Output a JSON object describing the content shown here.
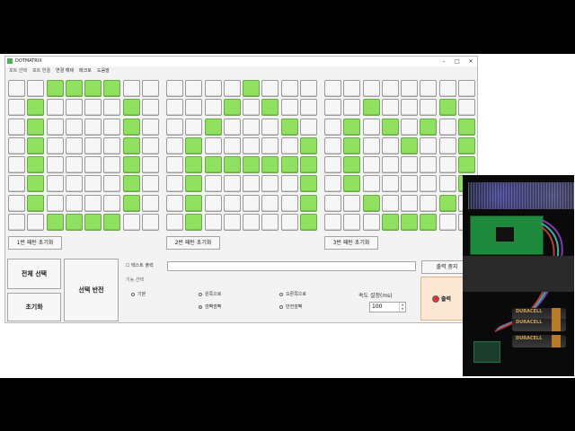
{
  "window": {
    "title": "DOTMATRIX",
    "controls": [
      "–",
      "□",
      "✕"
    ]
  },
  "menu": [
    "포트 선택",
    "포트 연결",
    "연결 해제",
    "매크로",
    "도움말"
  ],
  "panels": [
    {
      "reset_label": "1번 패턴 초기화",
      "rows": [
        [
          0,
          0,
          1,
          1,
          1,
          1,
          0,
          0
        ],
        [
          0,
          1,
          0,
          0,
          0,
          0,
          1,
          0
        ],
        [
          0,
          1,
          0,
          0,
          0,
          0,
          1,
          0
        ],
        [
          0,
          1,
          0,
          0,
          0,
          0,
          1,
          0
        ],
        [
          0,
          1,
          0,
          0,
          0,
          0,
          1,
          0
        ],
        [
          0,
          1,
          0,
          0,
          0,
          0,
          1,
          0
        ],
        [
          0,
          1,
          0,
          0,
          0,
          0,
          1,
          0
        ],
        [
          0,
          0,
          1,
          1,
          1,
          1,
          0,
          0
        ]
      ]
    },
    {
      "reset_label": "2번 패턴 초기화",
      "rows": [
        [
          0,
          0,
          0,
          0,
          1,
          0,
          0,
          0
        ],
        [
          0,
          0,
          0,
          1,
          0,
          1,
          0,
          0
        ],
        [
          0,
          0,
          1,
          0,
          0,
          0,
          1,
          0
        ],
        [
          0,
          1,
          0,
          0,
          0,
          0,
          0,
          1
        ],
        [
          0,
          1,
          1,
          1,
          1,
          1,
          1,
          1
        ],
        [
          0,
          1,
          0,
          0,
          0,
          0,
          0,
          1
        ],
        [
          0,
          1,
          0,
          0,
          0,
          0,
          0,
          1
        ],
        [
          0,
          1,
          0,
          0,
          0,
          0,
          0,
          1
        ]
      ]
    },
    {
      "reset_label": "3번 패턴 초기화",
      "rows": [
        [
          0,
          0,
          0,
          0,
          0,
          0,
          0,
          0
        ],
        [
          0,
          0,
          1,
          0,
          0,
          0,
          1,
          0
        ],
        [
          0,
          1,
          0,
          1,
          0,
          1,
          0,
          1
        ],
        [
          0,
          1,
          0,
          0,
          1,
          0,
          0,
          1
        ],
        [
          0,
          1,
          0,
          0,
          0,
          0,
          0,
          1
        ],
        [
          0,
          1,
          0,
          0,
          0,
          0,
          0,
          1
        ],
        [
          0,
          0,
          1,
          0,
          0,
          0,
          1,
          0
        ],
        [
          0,
          0,
          0,
          1,
          1,
          1,
          0,
          0
        ]
      ]
    }
  ],
  "buttons": {
    "select_all": "전체 선택",
    "reset": "초기화",
    "invert": "선택 반전",
    "stop_output": "출력 중지",
    "output": "출력"
  },
  "text_output": {
    "checkbox_label": "텍스트 출력",
    "value": ""
  },
  "function_select": {
    "label": "기능 선택",
    "options": [
      "기본",
      "왼쪽으로",
      "오른쪽으로",
      "깜빡깜빡",
      "반전깜빡"
    ],
    "selected": "깜빡깜빡"
  },
  "speed": {
    "label": "속도 설정(ms)",
    "value": "100"
  },
  "photo": {
    "battery_brand": "DURACELL"
  },
  "colors": {
    "led_on": "#8fe15f",
    "output_button_bg": "#fbe7d3"
  }
}
